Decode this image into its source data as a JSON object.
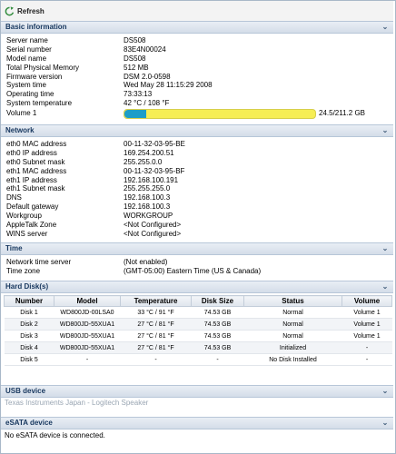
{
  "toolbar": {
    "refresh_label": "Refresh"
  },
  "sections": {
    "basic": {
      "title": "Basic information",
      "rows": [
        {
          "k": "Server name",
          "v": "DS508"
        },
        {
          "k": "Serial number",
          "v": "83E4N00024"
        },
        {
          "k": "Model name",
          "v": "DS508"
        },
        {
          "k": "Total Physical Memory",
          "v": "512 MB"
        },
        {
          "k": "Firmware version",
          "v": "DSM 2.0-0598"
        },
        {
          "k": "System time",
          "v": "Wed May 28 11:15:29 2008"
        },
        {
          "k": "Operating time",
          "v": "73:33:13"
        },
        {
          "k": "System temperature",
          "v": "42 °C / 108 °F"
        }
      ],
      "volume": {
        "label": "Volume 1",
        "text": "24.5/211.2 GB",
        "used_fraction": 0.116
      }
    },
    "network": {
      "title": "Network",
      "rows": [
        {
          "k": "eth0 MAC address",
          "v": "00-11-32-03-95-BE"
        },
        {
          "k": "eth0 IP address",
          "v": "169.254.200.51"
        },
        {
          "k": "eth0 Subnet mask",
          "v": "255.255.0.0"
        },
        {
          "k": "eth1 MAC address",
          "v": "00-11-32-03-95-BF"
        },
        {
          "k": "eth1 IP address",
          "v": "192.168.100.191"
        },
        {
          "k": "eth1 Subnet mask",
          "v": "255.255.255.0"
        },
        {
          "k": "DNS",
          "v": "192.168.100.3"
        },
        {
          "k": "Default gateway",
          "v": "192.168.100.3"
        },
        {
          "k": "Workgroup",
          "v": "WORKGROUP"
        },
        {
          "k": "AppleTalk Zone",
          "v": "<Not Configured>"
        },
        {
          "k": "WINS server",
          "v": "<Not Configured>"
        }
      ]
    },
    "time": {
      "title": "Time",
      "rows": [
        {
          "k": "Network time server",
          "v": "(Not enabled)"
        },
        {
          "k": "Time zone",
          "v": "(GMT-05:00) Eastern Time (US & Canada)"
        }
      ]
    },
    "disks": {
      "title": "Hard Disk(s)",
      "columns": [
        "Number",
        "Model",
        "Temperature",
        "Disk Size",
        "Status",
        "Volume"
      ],
      "rows": [
        [
          "Disk 1",
          "WD800JD-00LSA0",
          "33 °C / 91 °F",
          "74.53 GB",
          "Normal",
          "Volume 1"
        ],
        [
          "Disk 2",
          "WD800JD-55XUA1",
          "27 °C / 81 °F",
          "74.53 GB",
          "Normal",
          "Volume 1"
        ],
        [
          "Disk 3",
          "WD800JD-55XUA1",
          "27 °C / 81 °F",
          "74.53 GB",
          "Normal",
          "Volume 1"
        ],
        [
          "Disk 4",
          "WD800JD-55XUA1",
          "27 °C / 81 °F",
          "74.53 GB",
          "Initialized",
          "-"
        ],
        [
          "Disk 5",
          "-",
          "-",
          "-",
          "No Disk Installed",
          "-"
        ]
      ]
    },
    "usb": {
      "title": "USB device",
      "text": "Texas Instruments Japan - Logitech Speaker"
    },
    "esata": {
      "title": "eSATA device",
      "text": "No eSATA device is connected."
    }
  },
  "colors": {
    "header_text": "#17375e",
    "volume_used": "#1c9dc8",
    "volume_free": "#f6ee55"
  },
  "icons": {
    "refresh": "refresh-icon",
    "collapse": "collapse-chevron-icon"
  }
}
